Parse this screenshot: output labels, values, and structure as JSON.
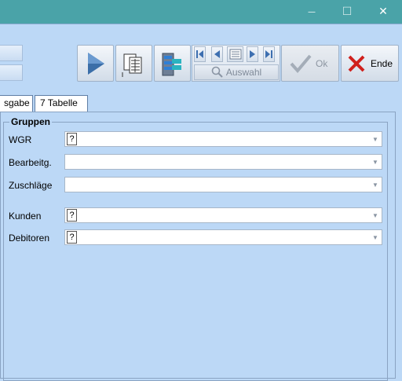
{
  "window": {
    "minimize_glyph": "—",
    "maximize_glyph": "☐",
    "close_glyph": "✕"
  },
  "toolbar": {
    "search_label": "Auswahl",
    "ok_label": "Ok",
    "end_label": "Ende",
    "icons": [
      "play-icon",
      "document-grid-icon",
      "database-icon",
      "nav-first-icon",
      "nav-prev-icon",
      "nav-list-icon",
      "nav-next-icon",
      "nav-last-icon",
      "magnifier-icon",
      "checkmark-icon",
      "red-x-icon"
    ]
  },
  "tabs": [
    {
      "label": "sgabe"
    },
    {
      "label": "7 Tabelle"
    }
  ],
  "group": {
    "title": "Gruppen",
    "fields": [
      {
        "label": "WGR",
        "value": "?"
      },
      {
        "label": "Bearbeitg.",
        "value": ""
      },
      {
        "label": "Zuschläge",
        "value": ""
      },
      {
        "label": "Kunden",
        "value": "?"
      },
      {
        "label": "Debitoren",
        "value": "?"
      }
    ]
  },
  "colors": {
    "titlebar": "#4aa3a8",
    "background": "#bcd8f6",
    "end_icon": "#d0201c",
    "play_icon": "#3b6ea8"
  }
}
